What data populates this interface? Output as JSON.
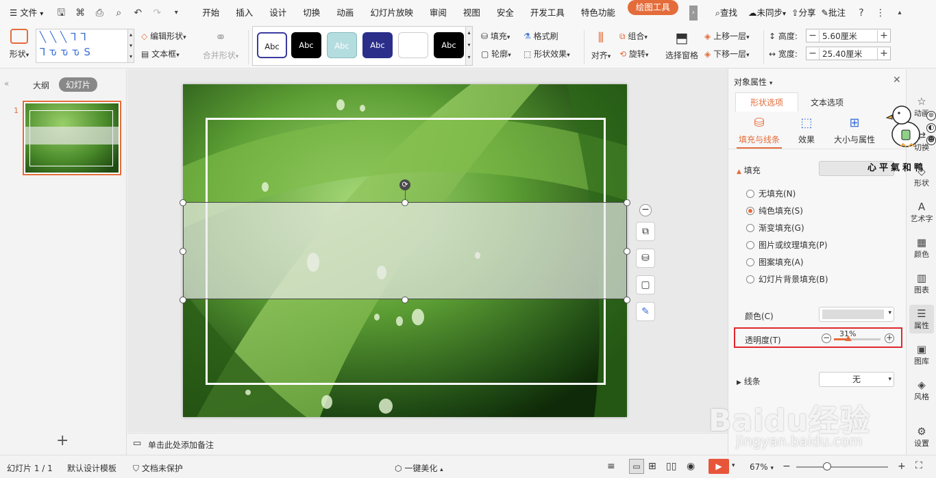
{
  "menubar": {
    "file_label": "文件",
    "tabs": [
      "开始",
      "插入",
      "设计",
      "切换",
      "动画",
      "幻灯片放映",
      "审阅",
      "视图",
      "安全",
      "开发工具",
      "特色功能"
    ],
    "active_tab": "绘图工具",
    "search": "查找",
    "sync": "未同步",
    "share": "分享",
    "comment": "批注"
  },
  "ribbon": {
    "shape": "形状",
    "edit_shape": "编辑形状",
    "text_box": "文本框",
    "merge_shape": "合并形状",
    "style_sample": "Abc",
    "fill": "填充",
    "format_brush": "格式刷",
    "outline": "轮廓",
    "shape_effect": "形状效果",
    "align": "对齐",
    "group": "组合",
    "rotate": "旋转",
    "select_pane": "选择窗格",
    "bring_forward": "上移一层",
    "send_backward": "下移一层",
    "height_label": "高度:",
    "height_value": "5.60厘米",
    "width_label": "宽度:",
    "width_value": "25.40厘米"
  },
  "leftpanel": {
    "outline_tab": "大纲",
    "slides_tab": "幻灯片",
    "slide_number": "1"
  },
  "notes": {
    "placeholder": "单击此处添加备注"
  },
  "rightpanel": {
    "title": "对象属性",
    "tab_shape": "形状选项",
    "tab_text": "文本选项",
    "sub_fill_line": "填充与线条",
    "sub_effect": "效果",
    "sub_size": "大小与属性",
    "fill_section": "填充",
    "options": [
      {
        "label": "无填充(N)",
        "checked": false
      },
      {
        "label": "纯色填充(S)",
        "checked": true
      },
      {
        "label": "渐变填充(G)",
        "checked": false
      },
      {
        "label": "图片或纹理填充(P)",
        "checked": false
      },
      {
        "label": "图案填充(A)",
        "checked": false
      },
      {
        "label": "幻灯片背景填充(B)",
        "checked": false
      }
    ],
    "color_label": "颜色(C)",
    "transparency_label": "透明度(T)",
    "transparency_value": "31%",
    "transparency_fraction": 0.31,
    "line_section": "线条",
    "line_value": "无"
  },
  "sidebar": {
    "items": [
      "动画",
      "切换",
      "形状",
      "艺术字",
      "颜色",
      "图表",
      "属性",
      "图库",
      "风格",
      "设置"
    ],
    "watermark_text": "心平氣和鸭"
  },
  "statusbar": {
    "slide_info": "幻灯片 1 / 1",
    "template": "默认设计模板",
    "protection": "文档未保护",
    "beautify": "一键美化",
    "zoom": "67%"
  },
  "watermark": {
    "brand": "Baidu经验",
    "url": "jingyan.baidu.com"
  },
  "colors": {
    "accent": "#e46c3a",
    "highlight_box": "#e0262c"
  }
}
